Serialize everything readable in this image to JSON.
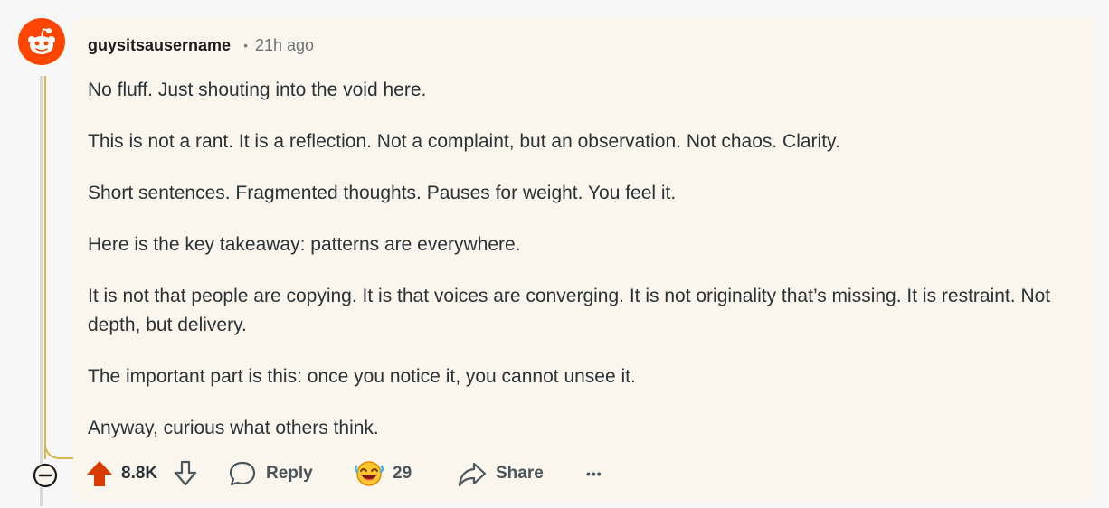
{
  "comment": {
    "username": "guysitsausername",
    "separator": "•",
    "time": "21h ago",
    "paragraphs": [
      "No fluff. Just shouting into the void here.",
      "This is not a rant. It is a reflection. Not a complaint, but an observation. Not chaos. Clarity.",
      "Short sentences. Fragmented thoughts. Pauses for weight. You feel it.",
      "Here is the key takeaway: patterns are everywhere.",
      "It is not that people are copying. It is that voices are converging. It is not originality that’s missing. It is restraint. Not depth, but delivery.",
      "The important part is this: once you notice it, you cannot unsee it.",
      "Anyway, curious what others think."
    ]
  },
  "actions": {
    "score": "8.8K",
    "reply_label": "Reply",
    "award_count": "29",
    "share_label": "Share",
    "more_label": "•••"
  },
  "icons": {
    "avatar": "reddit-snoo-icon",
    "upvote": "upvote-arrow-icon",
    "downvote": "downvote-arrow-icon",
    "reply": "speech-bubble-icon",
    "award": "laughing-award-icon",
    "share": "share-arrow-icon",
    "collapse": "collapse-minus-icon"
  },
  "colors": {
    "upvote_active": "#d93a00",
    "avatar_bg": "#ff4500",
    "card_bg": "#faf6ee",
    "thread_gold": "#d8b84a"
  }
}
